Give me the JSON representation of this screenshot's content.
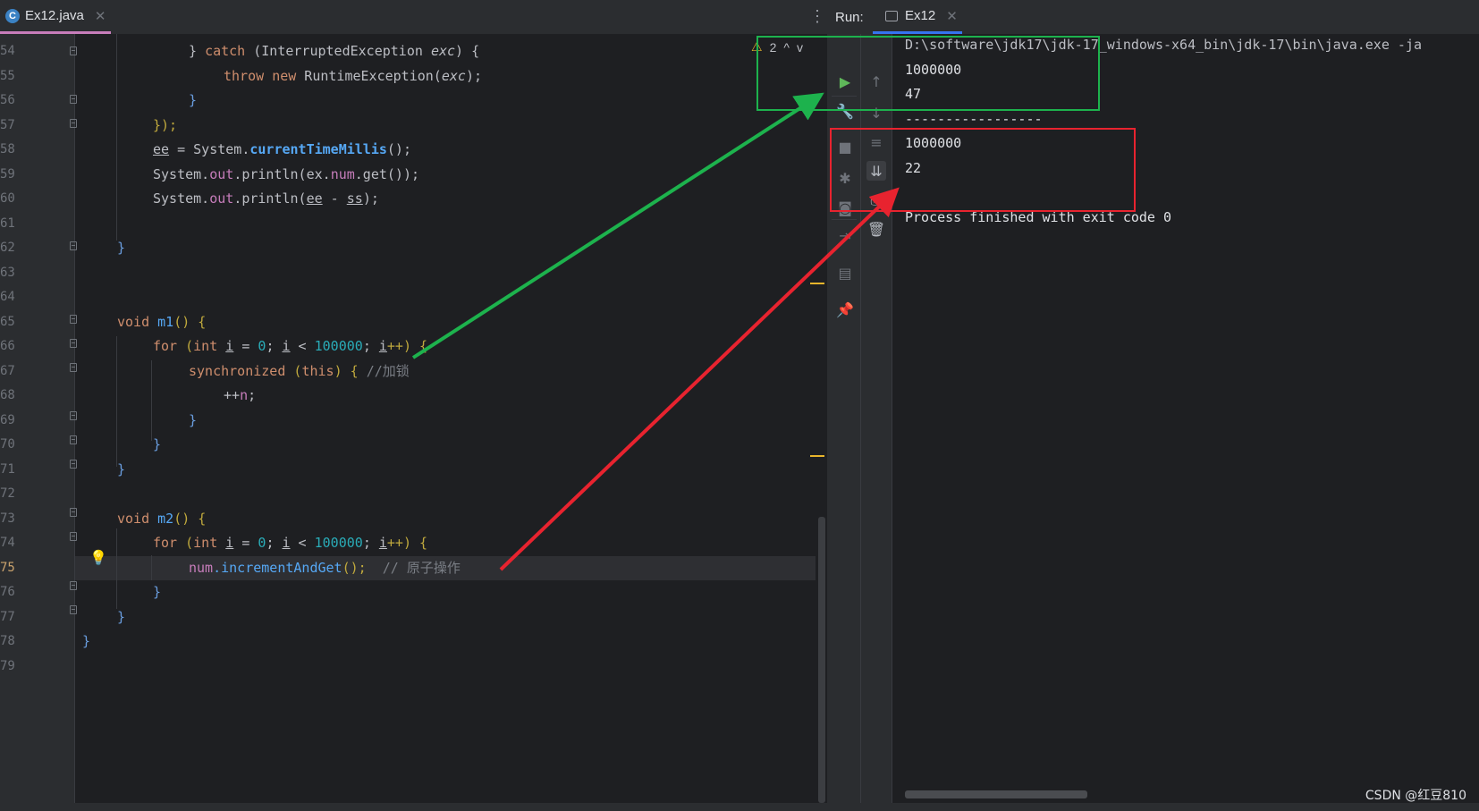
{
  "editor": {
    "tab_label": "Ex12.java",
    "tab_close": "✕",
    "kebab": "⋮",
    "inspections": {
      "warning_count": "2",
      "up": "^",
      "down": "v"
    },
    "line_numbers": [
      "54",
      "55",
      "56",
      "57",
      "58",
      "59",
      "60",
      "61",
      "62",
      "63",
      "64",
      "65",
      "66",
      "67",
      "68",
      "69",
      "70",
      "71",
      "72",
      "73",
      "74",
      "75",
      "76",
      "77",
      "78",
      "79"
    ],
    "current_line": "75",
    "code": {
      "l54": [
        "} ",
        "catch",
        " (InterruptedException ",
        "exc",
        ") {"
      ],
      "l55": [
        "throw",
        " ",
        "new",
        " RuntimeException(",
        "exc",
        ");"
      ],
      "l56": "}",
      "l57": "});",
      "l58": [
        "ee",
        " = System.",
        "currentTimeMillis",
        "();"
      ],
      "l59": [
        "System.",
        "out",
        ".println(ex.",
        "num",
        ".get());"
      ],
      "l60": [
        "System.",
        "out",
        ".println(",
        "ee",
        " - ",
        "ss",
        ");"
      ],
      "l62": "}",
      "l65": [
        "void",
        " m1",
        "() {"
      ],
      "l66": [
        "for",
        " (",
        "int",
        " ",
        "i",
        " = ",
        "0",
        "; ",
        "i",
        " < ",
        "100000",
        "; ",
        "i",
        "++) {"
      ],
      "l67": [
        "synchronized",
        " (",
        "this",
        ") { ",
        "//加锁"
      ],
      "l68": [
        "++",
        "n",
        ";"
      ],
      "l69": "}",
      "l70": "}",
      "l71": "}",
      "l73": [
        "void",
        " m2",
        "() {"
      ],
      "l74": [
        "for",
        " (",
        "int",
        " ",
        "i",
        " = ",
        "0",
        "; ",
        "i",
        " < ",
        "100000",
        "; ",
        "i",
        "++) {"
      ],
      "l75": [
        "num",
        ".incrementAndGet",
        "();",
        "  // 原子操作"
      ],
      "l76": "}",
      "l77": "}",
      "l78": "}"
    }
  },
  "run": {
    "label": "Run:",
    "tab_label": "Ex12",
    "tab_close": "✕",
    "toolbar_icons": [
      "rerun-icon",
      "wrench-icon",
      "stop-icon",
      "debug-icon",
      "camera-icon",
      "exit-icon",
      "layout-icon",
      "pin-icon"
    ],
    "toolbar2_icons": [
      "up-arrow-icon",
      "down-arrow-icon",
      "soft-wrap-icon",
      "scroll-to-end-icon",
      "print-icon",
      "trash-icon"
    ],
    "console": [
      "D:\\software\\jdk17\\jdk-17_windows-x64_bin\\jdk-17\\bin\\java.exe -ja",
      "1000000",
      "47",
      "-----------------",
      "1000000",
      "22",
      "",
      "Process finished with exit code 0"
    ]
  },
  "annotations": {
    "green": "#1db24d",
    "red": "#e8232f"
  },
  "watermark": "CSDN @红豆810"
}
